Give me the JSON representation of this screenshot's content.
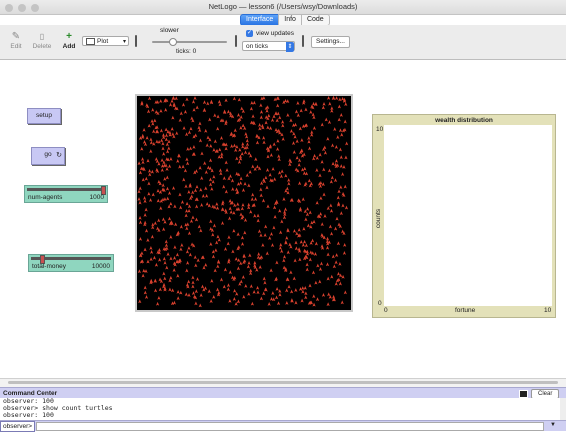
{
  "window": {
    "title": "NetLogo — lesson6 (/Users/wsy/Downloads)"
  },
  "tabs": [
    {
      "label": "Interface",
      "active": true
    },
    {
      "label": "Info",
      "active": false
    },
    {
      "label": "Code",
      "active": false
    }
  ],
  "toolbar": {
    "edit_label": "Edit",
    "delete_label": "Delete",
    "add_label": "Add",
    "widget_type": "Plot",
    "speed_label": "slower",
    "ticks_label": "ticks: 0",
    "view_updates_label": "view updates",
    "view_updates_checked": true,
    "update_mode": "on ticks",
    "settings_label": "Settings..."
  },
  "widgets": {
    "setup_label": "setup",
    "go_label": "go",
    "num_agents": {
      "label": "num-agents",
      "value": "1000",
      "fraction": 1.0
    },
    "total_money": {
      "label": "total-money",
      "value": "10000",
      "fraction": 0.12
    }
  },
  "plot": {
    "title": "wealth distribution",
    "ylabel": "counts",
    "xlabel": "fortune",
    "x_min": "0",
    "x_max": "10",
    "y_min": "0",
    "y_max": "10"
  },
  "world": {
    "agent_color": "#d9412e",
    "background": "#000000"
  },
  "command_center": {
    "title": "Command Center",
    "clear_label": "Clear",
    "output": [
      "observer: 100",
      "observer> show count turtles",
      "observer: 100"
    ],
    "prompt": "observer>"
  }
}
